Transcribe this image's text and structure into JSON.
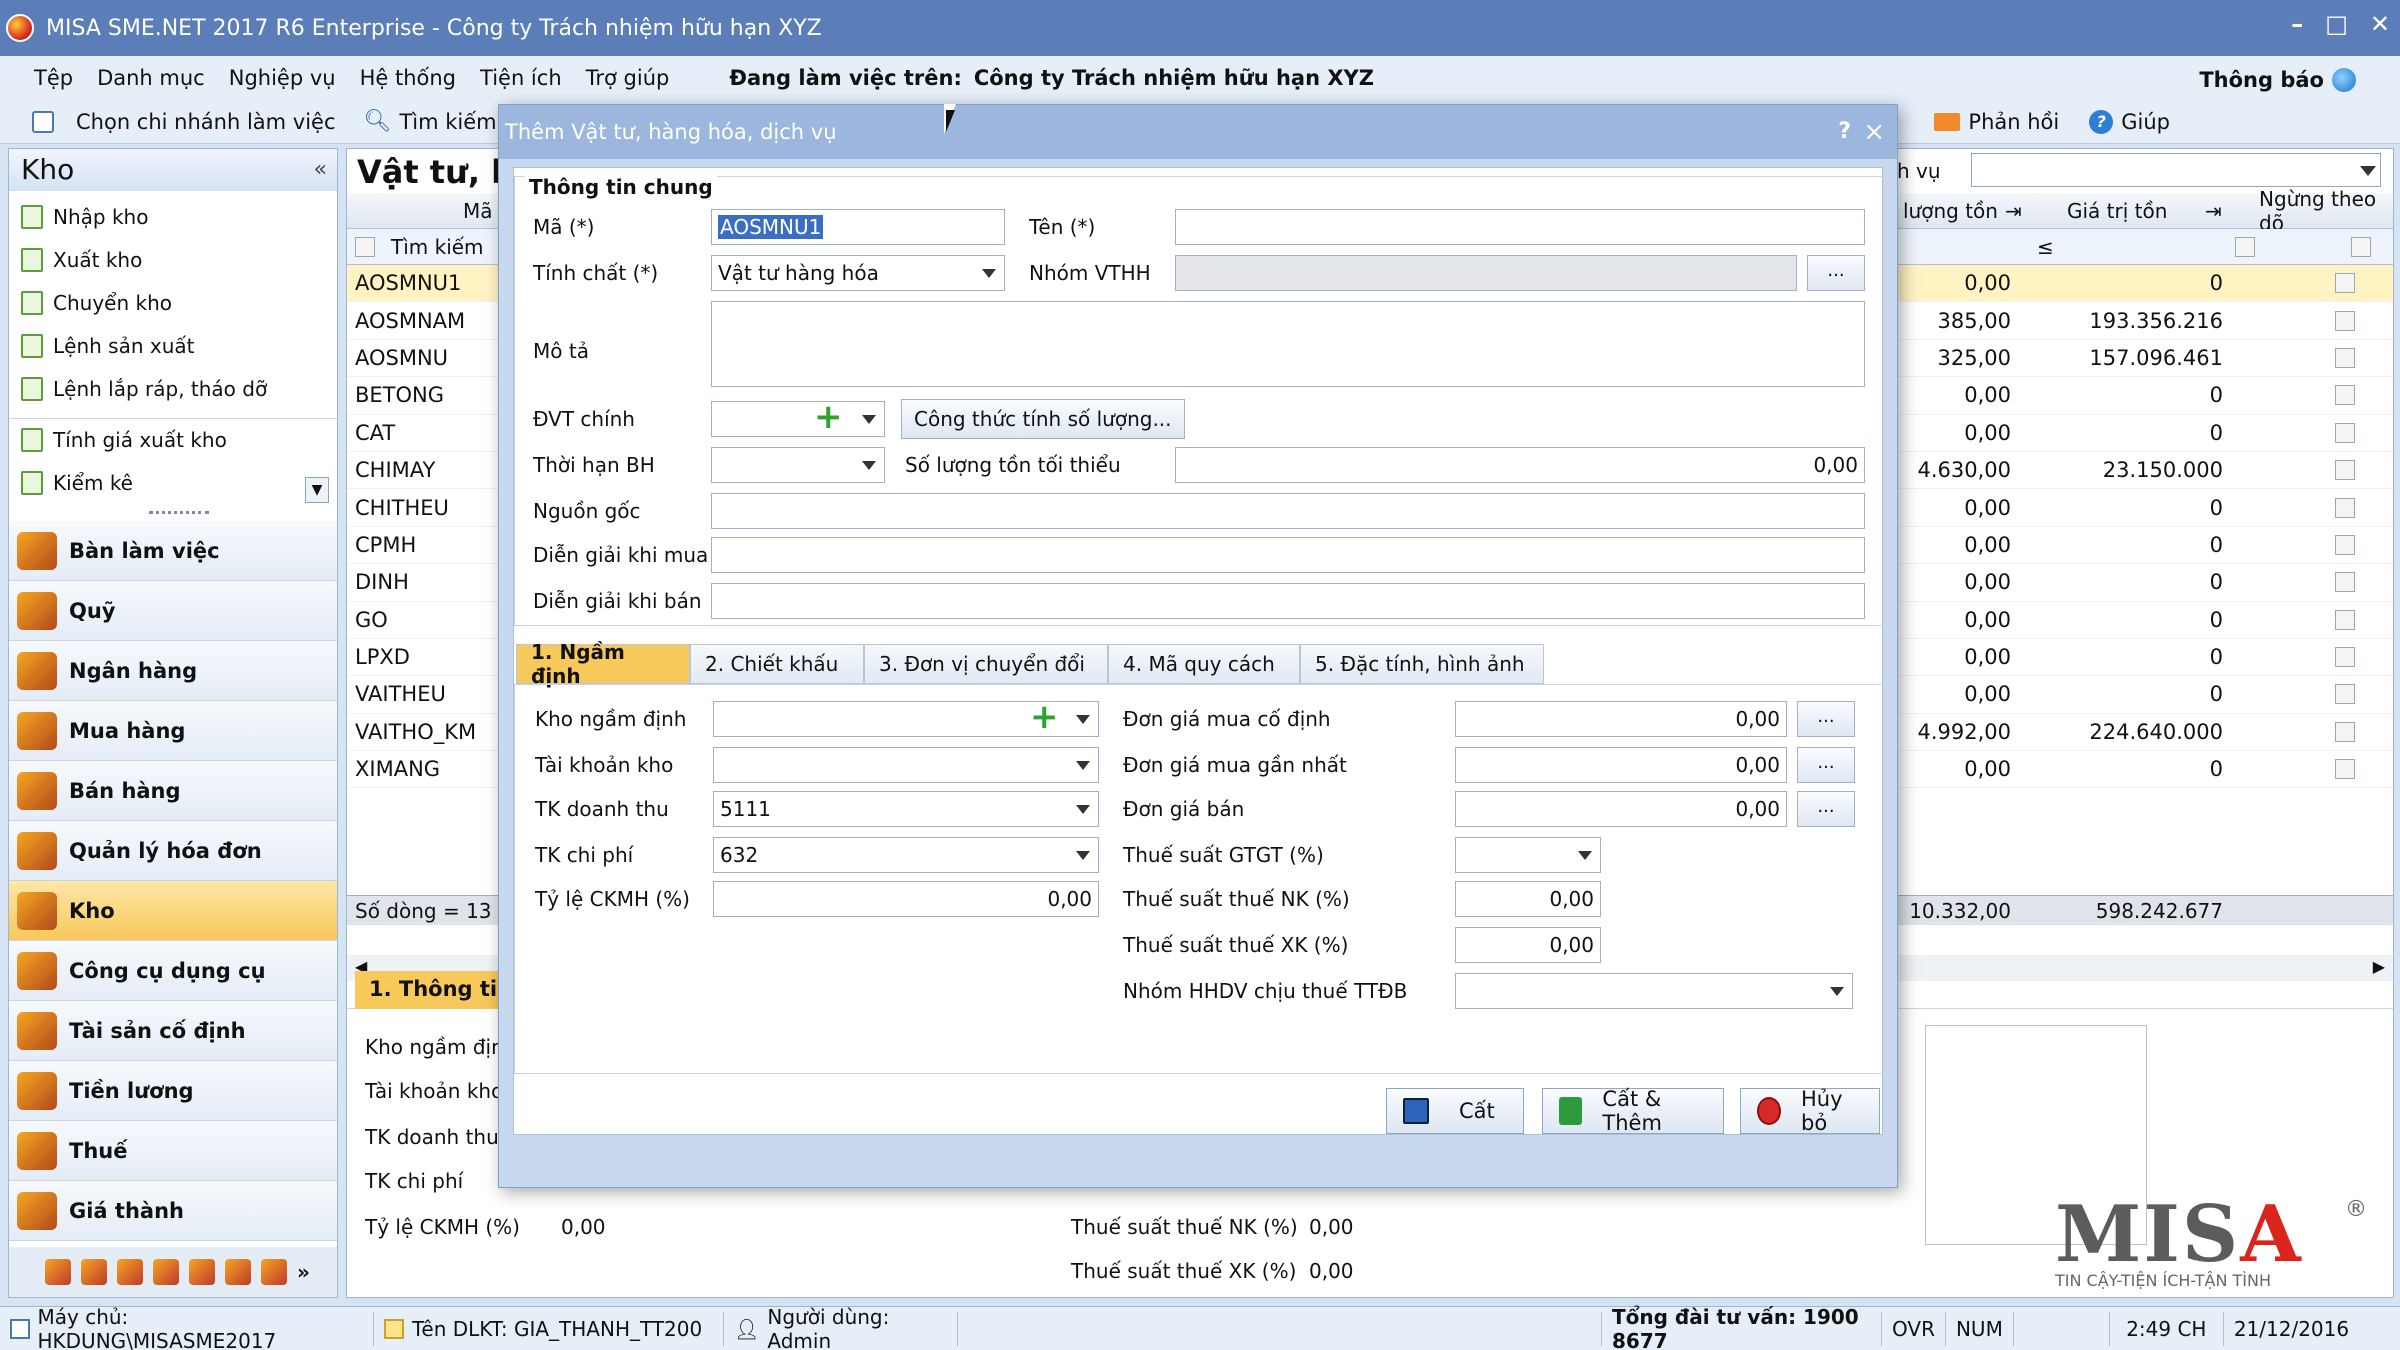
{
  "titlebar": {
    "title": "MISA SME.NET 2017 R6 Enterprise - Công ty Trách nhiệm hữu hạn XYZ"
  },
  "menu": {
    "items": [
      "Tệp",
      "Danh mục",
      "Nghiệp vụ",
      "Hệ thống",
      "Tiện ích",
      "Trợ giúp"
    ],
    "working_label": "Đang làm việc trên:",
    "working_company": "Công ty Trách nhiệm hữu hạn XYZ",
    "notify": "Thông báo"
  },
  "toolbar": {
    "branch": "Chọn chi nhánh làm việc",
    "search": "Tìm kiếm...",
    "feedback": "Phản hồi",
    "help": "Giúp"
  },
  "left": {
    "header": "Kho",
    "collapse": "«",
    "sub_items": [
      "Nhập kho",
      "Xuất kho",
      "Chuyển kho",
      "Lệnh sản xuất",
      "Lệnh lắp ráp, tháo dỡ",
      "Tính giá xuất kho",
      "Kiểm kê"
    ],
    "modules": [
      "Bàn làm việc",
      "Quỹ",
      "Ngân hàng",
      "Mua hàng",
      "Bán hàng",
      "Quản lý hóa đơn",
      "Kho",
      "Công cụ dụng cụ",
      "Tài sản cố định",
      "Tiền lương",
      "Thuế",
      "Giá thành"
    ]
  },
  "main": {
    "title": "Vật tư, hà",
    "filter_label": "h vụ",
    "columns": {
      "code": "Mã",
      "qty": "lượng tồn",
      "value": "Giá trị tồn",
      "stop": "Ngừng theo dõ"
    },
    "search_placeholder": "Tìm kiếm",
    "le_symbol": "≤",
    "rows": [
      {
        "code": "AOSMNU1",
        "qty": "0,00",
        "value": "0"
      },
      {
        "code": "AOSMNAM",
        "qty": "385,00",
        "value": "193.356.216"
      },
      {
        "code": "AOSMNU",
        "qty": "325,00",
        "value": "157.096.461"
      },
      {
        "code": "BETONG",
        "qty": "0,00",
        "value": "0"
      },
      {
        "code": "CAT",
        "qty": "0,00",
        "value": "0"
      },
      {
        "code": "CHIMAY",
        "qty": "4.630,00",
        "value": "23.150.000"
      },
      {
        "code": "CHITHEU",
        "qty": "0,00",
        "value": "0"
      },
      {
        "code": "CPMH",
        "qty": "0,00",
        "value": "0"
      },
      {
        "code": "DINH",
        "qty": "0,00",
        "value": "0"
      },
      {
        "code": "GO",
        "qty": "0,00",
        "value": "0"
      },
      {
        "code": "LPXD",
        "qty": "0,00",
        "value": "0"
      },
      {
        "code": "VAITHEU",
        "qty": "0,00",
        "value": "0"
      },
      {
        "code": "VAITHO_KM",
        "qty": "4.992,00",
        "value": "224.640.000"
      },
      {
        "code": "XIMANG",
        "qty": "0,00",
        "value": "0"
      }
    ],
    "row_count": "Số dòng = 13",
    "sum_qty": "10.332,00",
    "sum_value": "598.242.677",
    "detail_tab": "1. Thông tin",
    "detail_left": [
      "Kho ngầm định",
      "Tài khoản kho",
      "TK doanh thu",
      "TK chi phí",
      "Tỷ lệ CKMH (%)"
    ],
    "detail_ckmh_value": "0,00",
    "detail_right": [
      {
        "label": "Thuế suất thuế NK (%)",
        "value": "0,00"
      },
      {
        "label": "Thuế suất thuế XK (%)",
        "value": "0,00"
      }
    ],
    "logo": {
      "text_m": "M",
      "text_i": "I",
      "text_s": "S",
      "text_a": "A",
      "reg": "®",
      "tagline": "TIN CẬY-TIỆN ÍCH-TẬN TÌNH"
    }
  },
  "dialog": {
    "title": "Thêm Vật tư, hàng hóa, dịch vụ",
    "help": "?",
    "close": "×",
    "group_title": "Thông tin chung",
    "fields": {
      "code_label": "Mã (*)",
      "code_value": "AOSMNU1",
      "name_label": "Tên (*)",
      "name_value": "",
      "nature_label": "Tính chất (*)",
      "nature_value": "Vật tư hàng hóa",
      "group_label": "Nhóm VTHH",
      "desc_label": "Mô tả",
      "unit_label": "ĐVT chính",
      "formula_button": "Công thức tính số lượng...",
      "warranty_label": "Thời hạn BH",
      "min_stock_label": "Số lượng tồn tối thiểu",
      "min_stock_value": "0,00",
      "origin_label": "Nguồn gốc",
      "buy_desc_label": "Diễn giải khi mua",
      "sell_desc_label": "Diễn giải khi bán"
    },
    "tabs": [
      "1. Ngầm định",
      "2. Chiết khấu",
      "3. Đơn vị chuyển đổi",
      "4. Mã quy cách",
      "5. Đặc tính, hình ảnh"
    ],
    "defaults": {
      "warehouse_label": "Kho ngầm định",
      "account_label": "Tài khoản kho",
      "revenue_label": "TK doanh thu",
      "revenue_value": "5111",
      "expense_label": "TK chi phí",
      "expense_value": "632",
      "discount_label": "Tỷ lệ CKMH (%)",
      "discount_value": "0,00",
      "fixed_price_label": "Đơn giá mua cố định",
      "fixed_price_value": "0,00",
      "last_price_label": "Đơn giá mua gần nhất",
      "last_price_value": "0,00",
      "sale_price_label": "Đơn giá bán",
      "sale_price_value": "0,00",
      "vat_label": "Thuế suất GTGT (%)",
      "import_tax_label": "Thuế suất thuế NK (%)",
      "import_tax_value": "0,00",
      "export_tax_label": "Thuế suất thuế XK (%)",
      "export_tax_value": "0,00",
      "ttdb_label": "Nhóm HHDV chịu thuế TTĐB"
    },
    "ellipsis": "...",
    "buttons": {
      "save": "Cất",
      "save_add": "Cất & Thêm",
      "cancel": "Hủy bỏ"
    }
  },
  "status": {
    "server": "Máy chủ: HKDUNG\\MISASME2017",
    "db": "Tên DLKT: GIA_THANH_TT200",
    "user": "Người dùng: Admin",
    "hotline": "Tổng đài tư vấn: 1900 8677",
    "ovr": "OVR",
    "num": "NUM",
    "time": "2:49 CH",
    "date": "21/12/2016"
  }
}
